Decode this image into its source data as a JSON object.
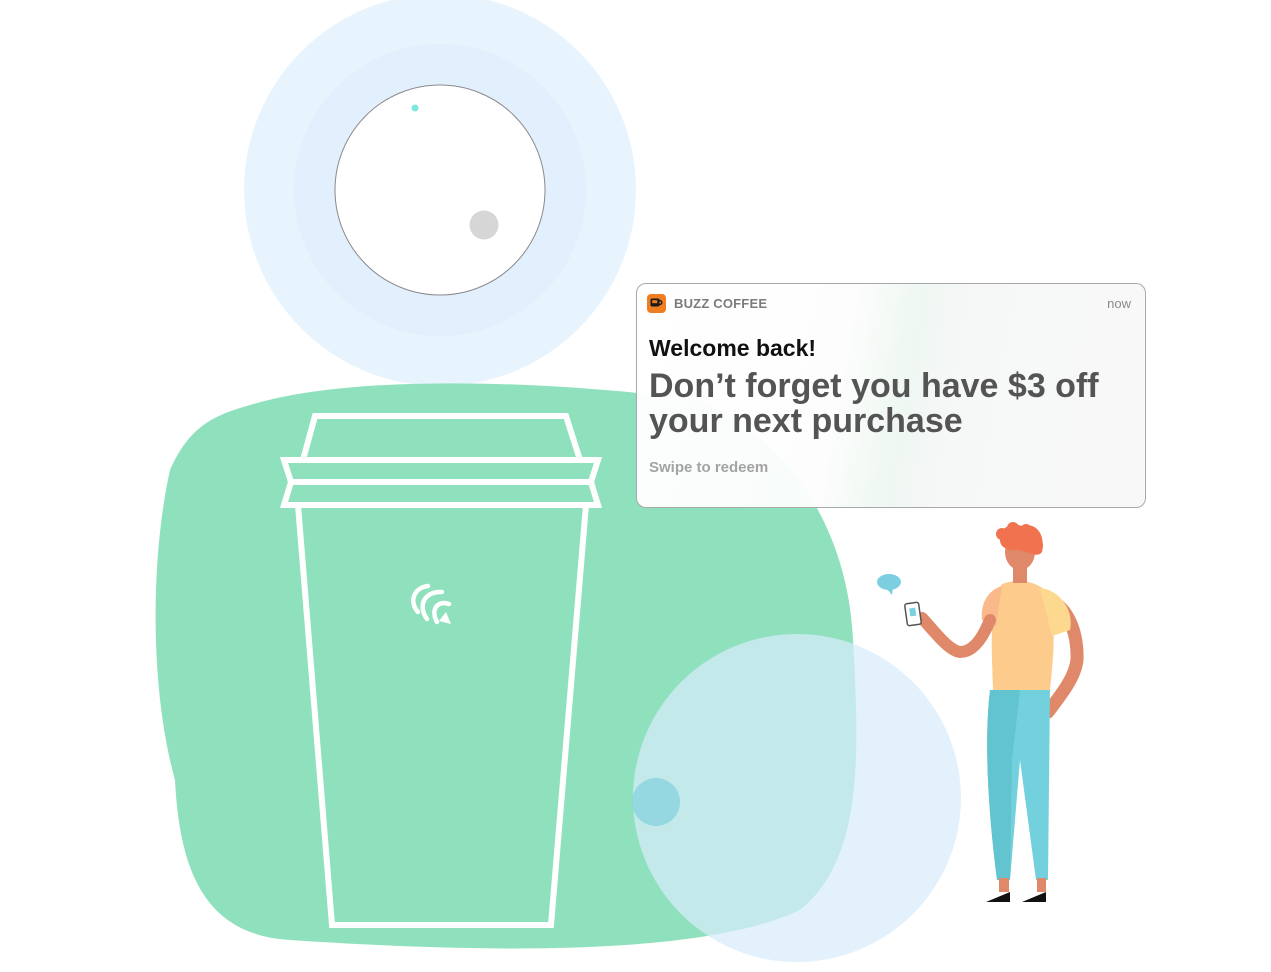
{
  "notification": {
    "app_icon": "coffee-cup-icon",
    "app_name": "BUZZ COFFEE",
    "timestamp": "now",
    "title": "Welcome back!",
    "message": "Don’t forget you have $3 off your next purchase",
    "action_hint": "Swipe to redeem"
  },
  "illustration": {
    "elements": [
      "profile-avatar-circle",
      "coffee-cup",
      "brand-logo",
      "person-holding-phone",
      "speech-bubble"
    ]
  },
  "colors": {
    "background_blob": "#8fe1bd",
    "halo_outer": "#e8f4fd",
    "halo_inner": "#e2effd",
    "cup_outline": "#ffffff",
    "accent_orange": "#ef7d22",
    "skin": "#e0896a",
    "hair": "#f0724f",
    "shirt": "#fdcb8c",
    "pants": "#72d1dc"
  }
}
